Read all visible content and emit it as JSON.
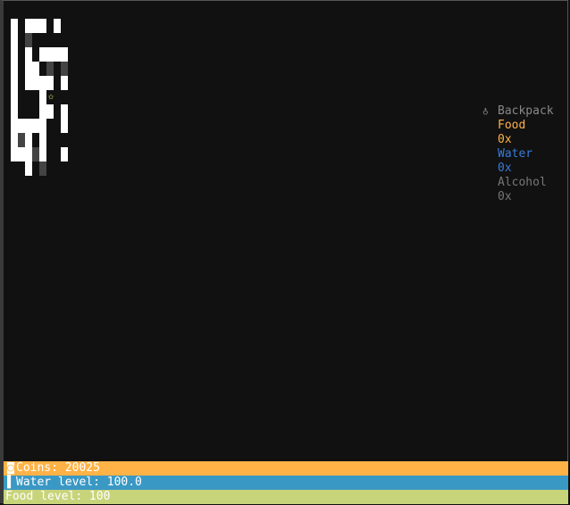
{
  "colors": {
    "background": "#111111",
    "wall": "#ffffff",
    "shadow": "#444444",
    "food": "#ffb347",
    "water": "#3a7bd5",
    "alcohol": "#777777",
    "coins_bar": "#ffb347",
    "water_bar": "#3a98c4",
    "food_bar": "#c8d47a"
  },
  "backpack": {
    "icon": "bag-icon",
    "title": "Backpack",
    "items": [
      {
        "name": "Food",
        "count": "0x",
        "color": "#ffb347"
      },
      {
        "name": "Water",
        "count": "0x",
        "color": "#3a7bd5"
      },
      {
        "name": "Alcohol",
        "count": "0x",
        "color": "#777777"
      }
    ]
  },
  "status": {
    "coins": {
      "icon": "coin-icon",
      "text": "Coins: 20025"
    },
    "water": {
      "icon": "water-icon",
      "text": "Water level: 100.0"
    },
    "food": {
      "text": "Food level: 100"
    }
  },
  "player": {
    "icon": "star-icon",
    "glyph": "✩"
  }
}
